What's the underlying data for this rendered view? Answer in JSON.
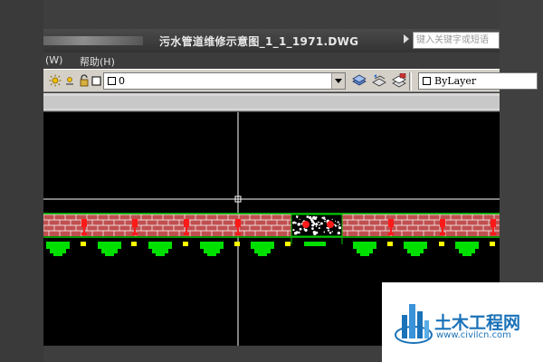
{
  "window": {
    "title": "污水管道维修示意图_1_1_1971.DWG",
    "search_placeholder": "键入关键字或短语"
  },
  "menubar": {
    "items": [
      {
        "label": "(W)"
      },
      {
        "label": "帮助(H)"
      }
    ]
  },
  "toolbar": {
    "layer_value": "0",
    "color_value": "ByLayer",
    "icons": [
      "sun-icon",
      "lock-icon",
      "layer-state-icon",
      "layer-previous-icon",
      "layer-match-icon"
    ]
  },
  "watermark": {
    "brand": "土木工程网",
    "url": "www.civilcn.com"
  },
  "colors": {
    "brick": "#c05050",
    "mortar": "#ffffff",
    "hatch_green": "#00c800",
    "fill_green": "#00e000",
    "marker_red": "#ff1a1a",
    "marker_yellow": "#ffff00",
    "crosshair": "#ffffff",
    "canvas": "#000000",
    "logo_blue": "#1a72b8"
  }
}
